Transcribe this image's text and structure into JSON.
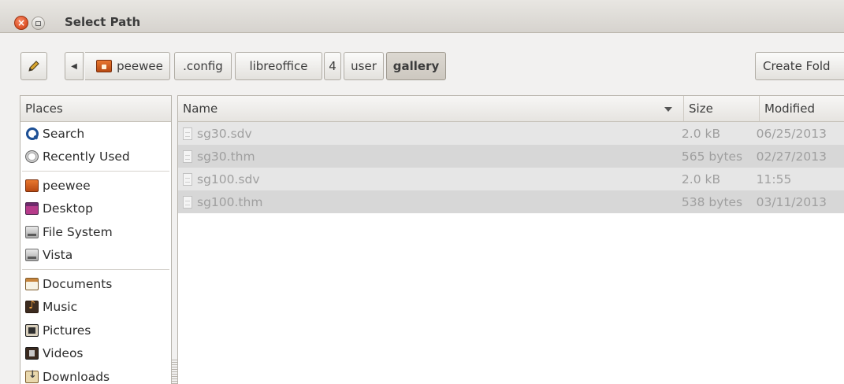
{
  "window": {
    "title": "Select Path",
    "close_glyph": "×"
  },
  "toolbar": {
    "back_glyph": "◀",
    "breadcrumbs": [
      "peewee",
      ".config",
      "libreoffice",
      "4",
      "user",
      "gallery"
    ],
    "active_crumb": "gallery",
    "create_folder_label": "Create Fold"
  },
  "places": {
    "header": "Places",
    "items": [
      {
        "label": "Search",
        "icon": "search-icon"
      },
      {
        "label": "Recently Used",
        "icon": "recent-icon"
      },
      {
        "label": "peewee",
        "icon": "home-folder-icon"
      },
      {
        "label": "Desktop",
        "icon": "desktop-icon"
      },
      {
        "label": "File System",
        "icon": "drive-icon"
      },
      {
        "label": "Vista",
        "icon": "drive-icon"
      },
      {
        "label": "Documents",
        "icon": "documents-icon"
      },
      {
        "label": "Music",
        "icon": "music-icon"
      },
      {
        "label": "Pictures",
        "icon": "pictures-icon"
      },
      {
        "label": "Videos",
        "icon": "videos-icon"
      },
      {
        "label": "Downloads",
        "icon": "downloads-icon"
      }
    ]
  },
  "files": {
    "columns": {
      "name": "Name",
      "size": "Size",
      "modified": "Modified"
    },
    "sort_column": "name",
    "rows": [
      {
        "name": "sg30.sdv",
        "size": "2.0 kB",
        "modified": "06/25/2013"
      },
      {
        "name": "sg30.thm",
        "size": "565 bytes",
        "modified": "02/27/2013"
      },
      {
        "name": "sg100.sdv",
        "size": "2.0 kB",
        "modified": "11:55"
      },
      {
        "name": "sg100.thm",
        "size": "538 bytes",
        "modified": "03/11/2013"
      }
    ]
  },
  "colors": {
    "title_bar": "#dedbd6",
    "close_button": "#e0562c",
    "row_odd": "#e6e6e6",
    "row_even": "#d7d7d7",
    "dimmed_text": "#9f9f9f"
  }
}
